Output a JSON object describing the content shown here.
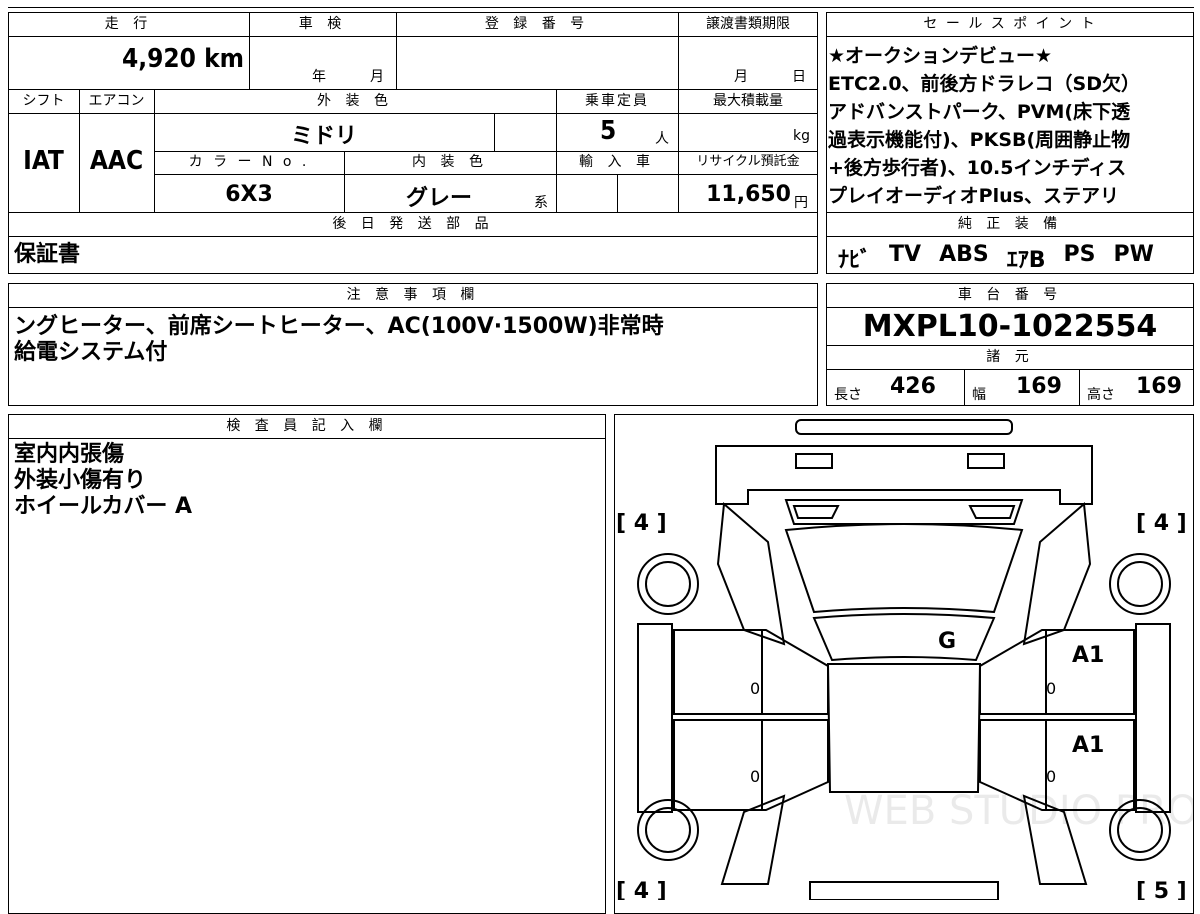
{
  "vehicle_info": {
    "labels": {
      "mileage": "走 行",
      "inspection": "車 検",
      "registration": "登 録 番 号",
      "transfer_deadline": "譲渡書類期限",
      "shift": "シフト",
      "aircon": "エアコン",
      "exterior_color": "外 装 色",
      "capacity": "乗車定員",
      "max_load": "最大積載量",
      "color_no": "カ ラ ー N o .",
      "interior_color": "内 装 色",
      "import": "輸 入 車",
      "recycle_fee": "リサイクル預託金",
      "later_parts": "後 日 発 送 部 品"
    },
    "mileage": "4,920 km",
    "inspection_year": "年",
    "inspection_month": "月",
    "transfer_month": "月",
    "transfer_day": "日",
    "shift": "IAT",
    "aircon": "AAC",
    "exterior_color": "ミドリ",
    "capacity": "5",
    "capacity_unit": "人",
    "max_load_unit": "kg",
    "color_no": "6X3",
    "interior_color": "グレー",
    "interior_suffix": "系",
    "recycle_fee": "11,650",
    "recycle_unit": "円",
    "later_parts": "保証書"
  },
  "sales_point": {
    "title": "セ ー ル ス ポ イ ン ト",
    "lines": [
      "★オークションデビュー★",
      "ETC2.0、前後方ドラレコ（SD欠）",
      "アドバンストパーク、PVM(床下透",
      "過表示機能付)、PKSB(周囲静止物",
      "+後方歩行者)、10.5インチディス",
      "プレイオーディオPlus、ステアリ"
    ]
  },
  "equipment": {
    "title": "純 正 装 備",
    "items": [
      "ﾅﾋﾞ",
      "TV",
      "ABS",
      "ｴｱB",
      "PS",
      "PW"
    ]
  },
  "notes": {
    "title": "注 意 事 項 欄",
    "lines": [
      "ングヒーター、前席シートヒーター、AC(100V·1500W)非常時",
      "給電システム付"
    ]
  },
  "chassis": {
    "title": "車 台 番 号",
    "number": "MXPL10-1022554",
    "spec_title": "諸 元",
    "length_label": "長さ",
    "length": "426",
    "width_label": "幅",
    "width": "169",
    "height_label": "高さ",
    "height": "169"
  },
  "inspector": {
    "title": "検 査 員 記 入 欄",
    "lines": [
      "室内内張傷",
      "外装小傷有り",
      "ホイールカバー A"
    ]
  },
  "diagram": {
    "tire_front_left": "[ 4 ]",
    "tire_front_right": "[ 4 ]",
    "tire_rear_left": "[ 4 ]",
    "tire_rear_right": "[ 5 ]",
    "mark_roof": "G",
    "mark_right_front_door": "A1",
    "mark_right_rear_door": "A1",
    "zero_lf": "0",
    "zero_lr": "0",
    "zero_rf": "0",
    "zero_rr": "0",
    "watermark": "WEB STUDIO PRO"
  }
}
